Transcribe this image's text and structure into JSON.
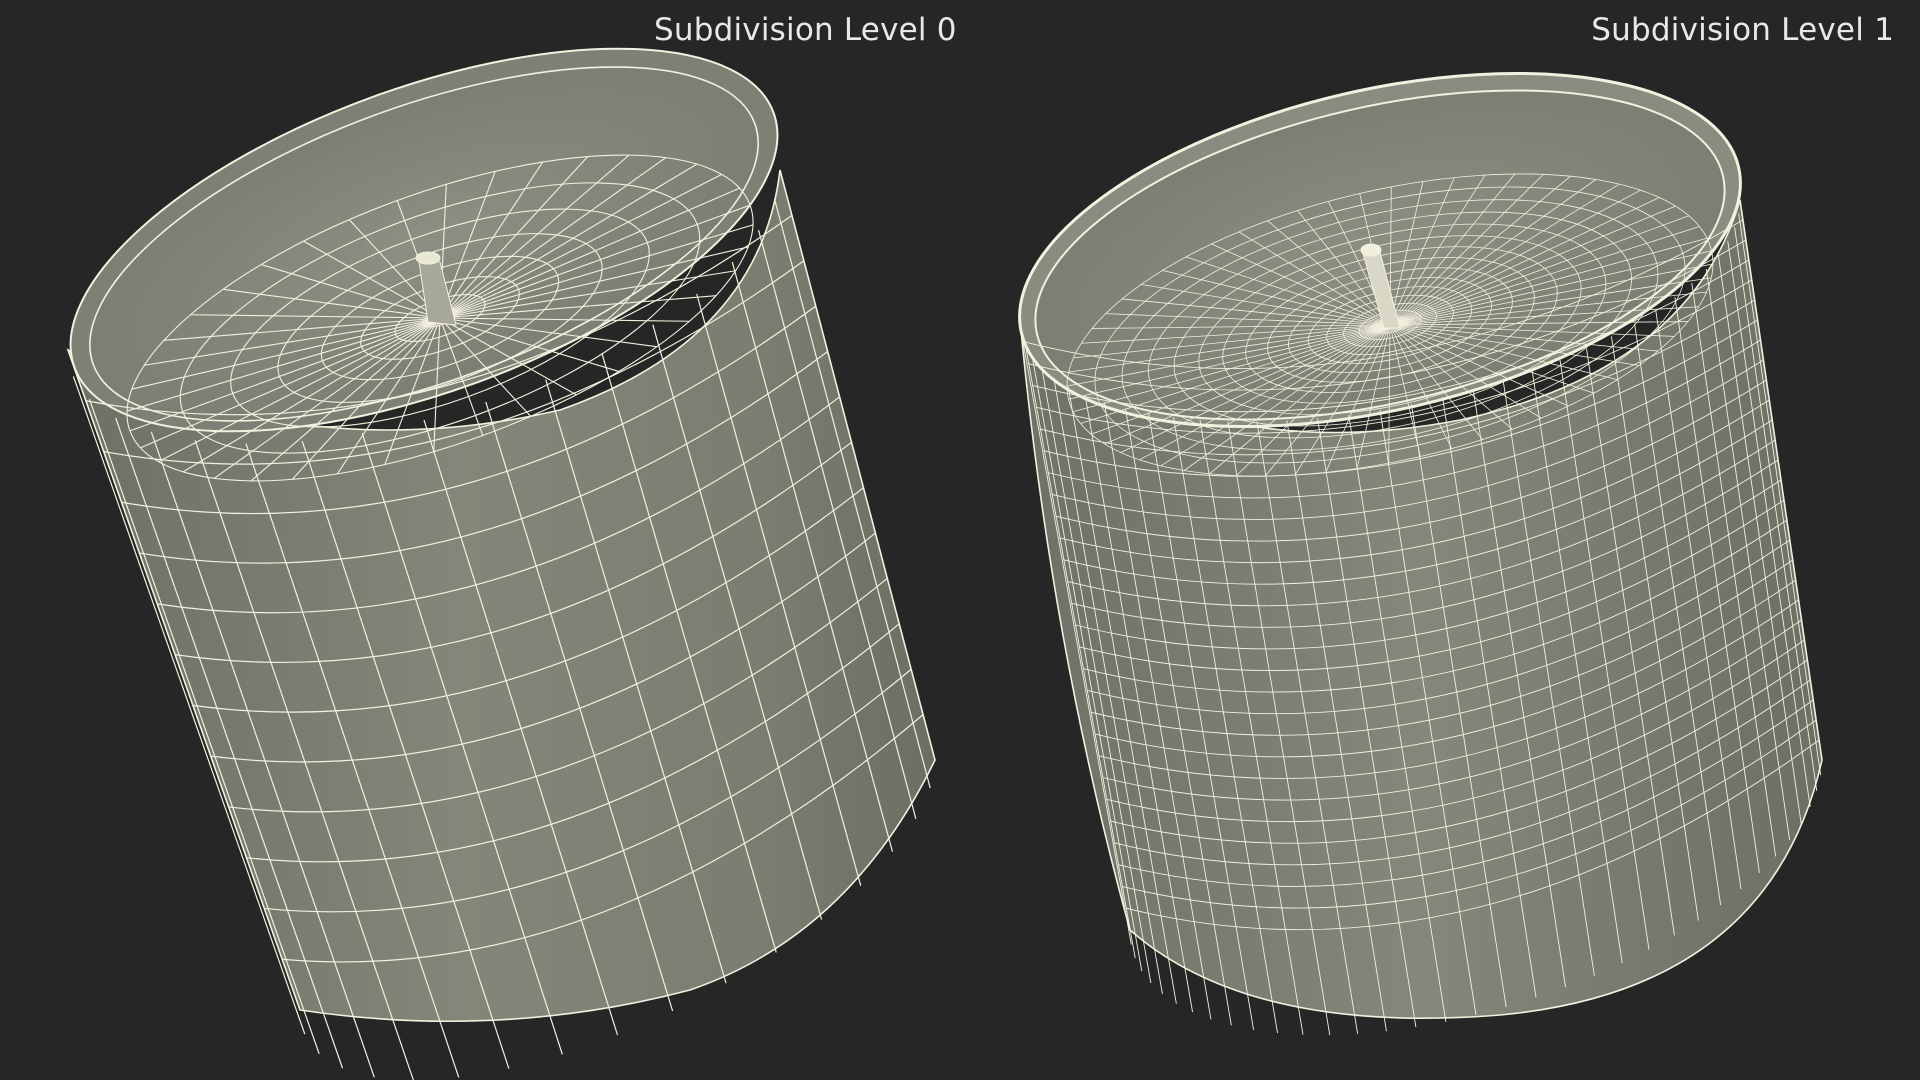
{
  "labels": {
    "left": "Subdivision Level 0",
    "right": "Subdivision Level 1"
  },
  "colors": {
    "background": "#262626",
    "surface": "#8a8b7f",
    "wire": "#f2f1df"
  },
  "models": [
    {
      "name": "subdivision-level-0",
      "grid": "coarse"
    },
    {
      "name": "subdivision-level-1",
      "grid": "fine"
    }
  ]
}
